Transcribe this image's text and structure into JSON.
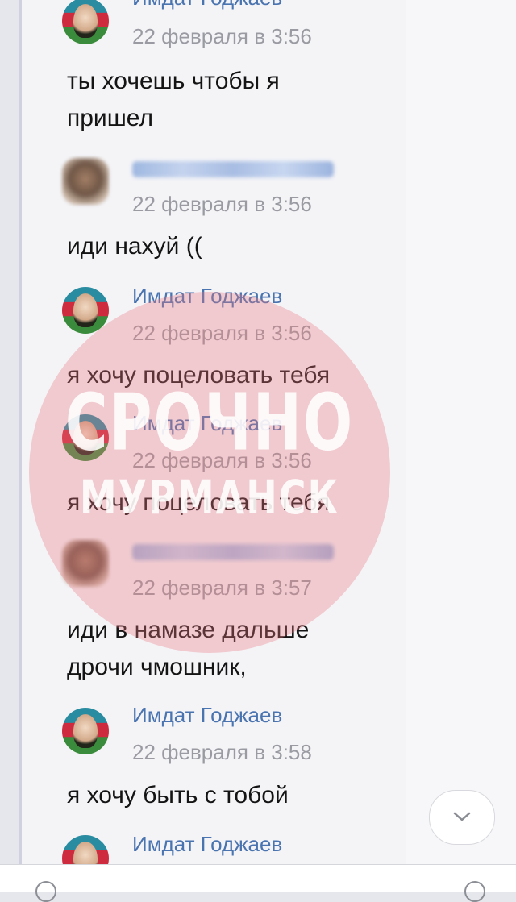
{
  "messages": [
    {
      "author": "Имдат Годжаев",
      "time": "22 февраля в 3:56",
      "text": "ты хочешь чтобы я пришел",
      "redacted": false
    },
    {
      "author": "",
      "time": "22 февраля в 3:56",
      "text": "иди нахуй ((",
      "redacted": true
    },
    {
      "author": "Имдат Годжаев",
      "time": "22 февраля в 3:56",
      "text": "я хочу поцеловать тебя",
      "redacted": false
    },
    {
      "author": "Имдат Годжаев",
      "time": "22 февраля в 3:56",
      "text": "я хочу поцеловать тебя",
      "redacted": false
    },
    {
      "author": "",
      "time": "22 февраля в 3:57",
      "text": "иди в намазе дальше дрочи чмошник,",
      "redacted": true
    },
    {
      "author": "Имдат Годжаев",
      "time": "22 февраля в 3:58",
      "text": "я хочу быть с тобой",
      "redacted": false
    },
    {
      "author": "Имдат Годжаев",
      "time": "",
      "text": "",
      "redacted": false
    }
  ],
  "watermark": {
    "line1": "СРОЧНО",
    "line2": "МУРМАНСК"
  },
  "scroll_button": {
    "icon": "chevron-down-icon"
  },
  "colors": {
    "author": "#4a74b0",
    "time": "#9a9ba2",
    "watermark": "#e97680"
  }
}
